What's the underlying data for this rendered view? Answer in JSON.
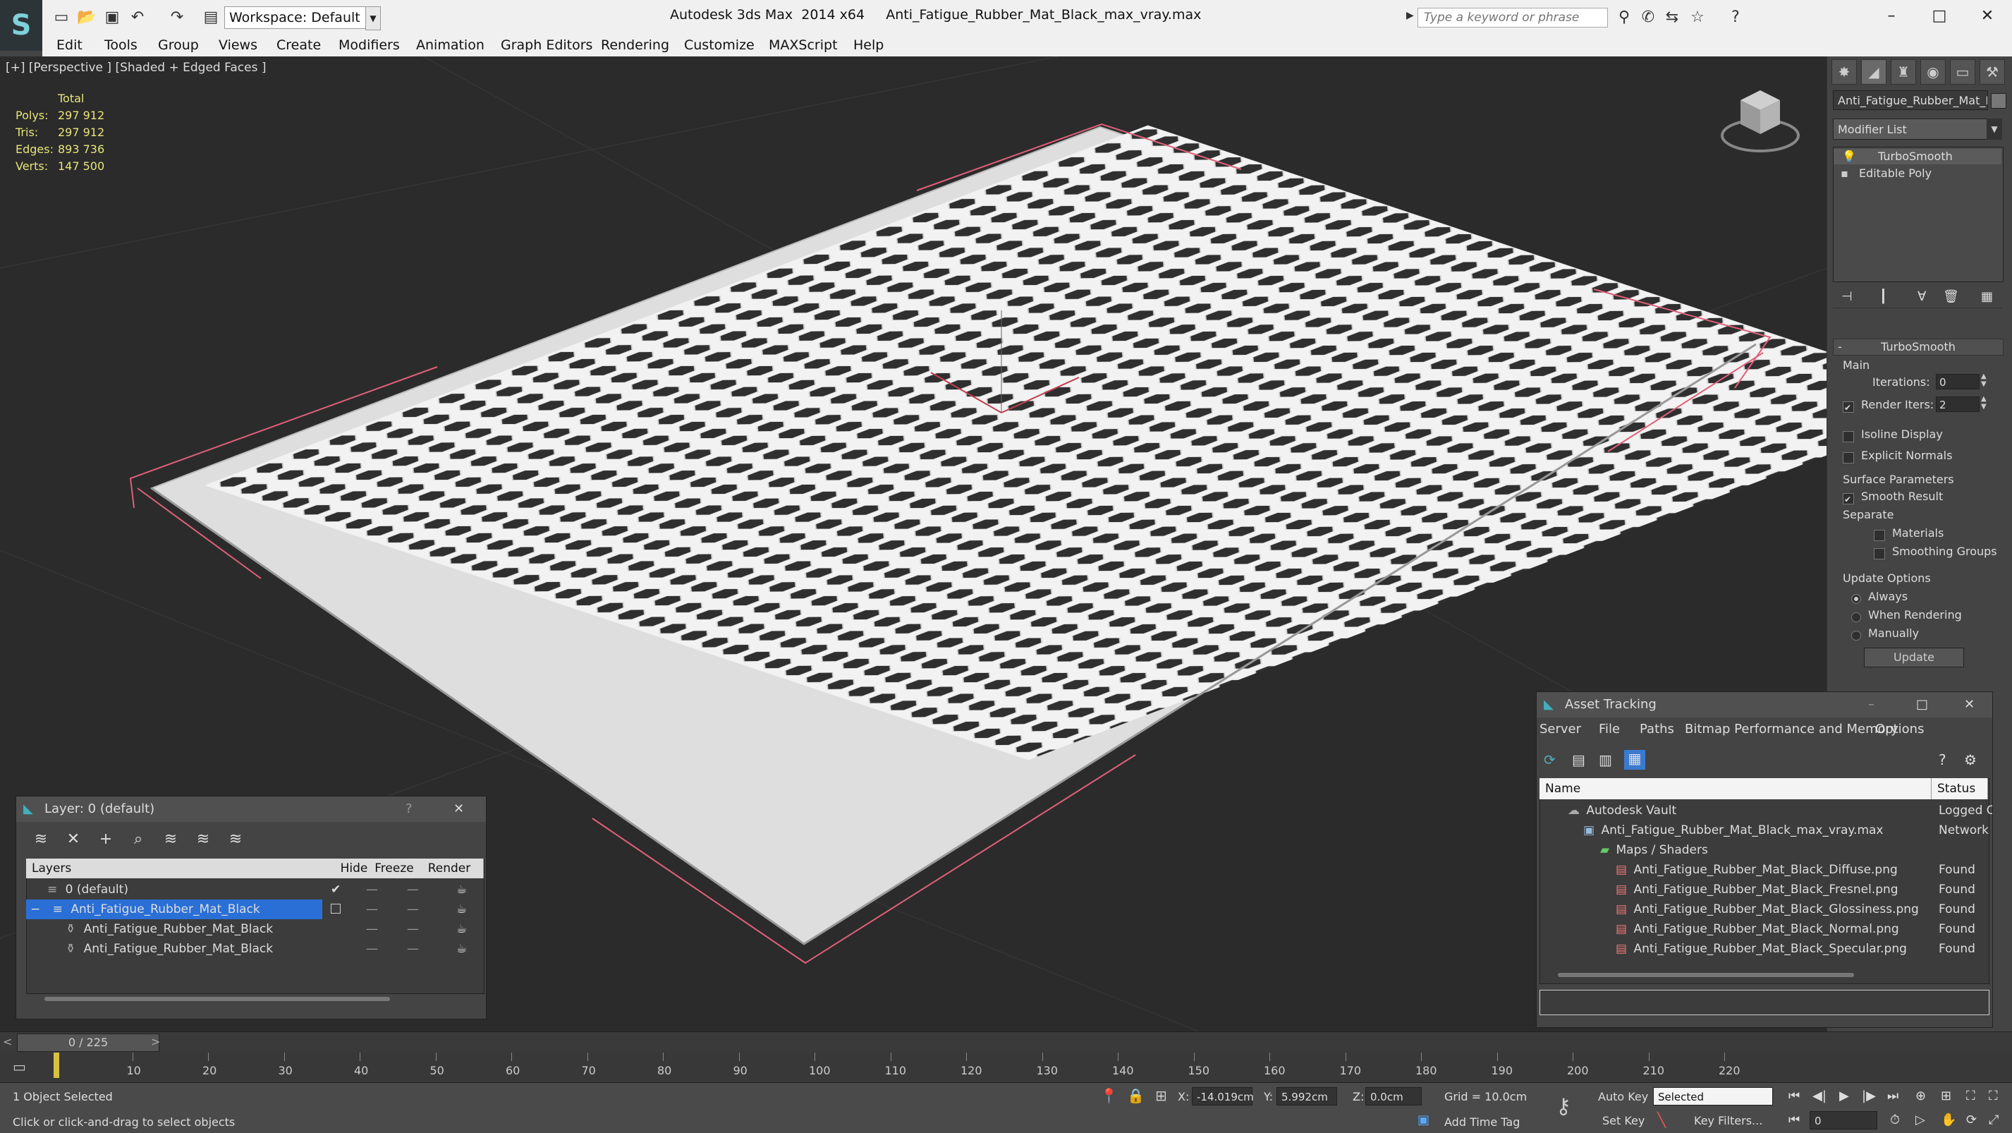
{
  "app": {
    "logo_glyph": "S",
    "title": "Autodesk 3ds Max  2014 x64     Anti_Fatigue_Rubber_Mat_Black_max_vray.max",
    "workspace": "Workspace: Default",
    "search_placeholder": "Type a keyword or phrase"
  },
  "menu": [
    "Edit",
    "Tools",
    "Group",
    "Views",
    "Create",
    "Modifiers",
    "Animation",
    "Graph Editors",
    "Rendering",
    "Customize",
    "MAXScript",
    "Help"
  ],
  "viewport": {
    "label": "[+] [Perspective ] [Shaded + Edged Faces ]",
    "stats": {
      "header": "Total",
      "rows": [
        {
          "label": "Polys:",
          "value": "297 912"
        },
        {
          "label": "Tris:",
          "value": "297 912"
        },
        {
          "label": "Edges:",
          "value": "893 736"
        },
        {
          "label": "Verts:",
          "value": "147 500"
        }
      ]
    }
  },
  "command_panel": {
    "object_name": "Anti_Fatigue_Rubber_Mat_Bl",
    "modifier_list": "Modifier List",
    "stack": [
      "TurboSmooth",
      "Editable Poly"
    ],
    "rollout_title": "TurboSmooth",
    "main_label": "Main",
    "iterations_label": "Iterations:",
    "iterations_value": "0",
    "render_iters_label": "Render Iters:",
    "render_iters_value": "2",
    "isoline": "Isoline Display",
    "explicit": "Explicit Normals",
    "surface_params": "Surface Parameters",
    "smooth_result": "Smooth Result",
    "separate": "Separate",
    "materials": "Materials",
    "smoothing_groups": "Smoothing Groups",
    "update_options": "Update Options",
    "always": "Always",
    "when_rendering": "When Rendering",
    "manually": "Manually",
    "update_button": "Update"
  },
  "layer_window": {
    "title": "Layer: 0 (default)",
    "help": "?",
    "close": "✕",
    "columns": [
      "Layers",
      "Hide",
      "Freeze",
      "Render"
    ],
    "rows": [
      {
        "name": "0 (default)",
        "selected": false,
        "indent": 0
      },
      {
        "name": "Anti_Fatigue_Rubber_Mat_Black",
        "selected": true,
        "indent": 0
      },
      {
        "name": "Anti_Fatigue_Rubber_Mat_Black",
        "selected": false,
        "indent": 1
      },
      {
        "name": "Anti_Fatigue_Rubber_Mat_Black",
        "selected": false,
        "indent": 1
      }
    ]
  },
  "asset_window": {
    "title": "Asset Tracking",
    "menu": [
      "Server",
      "File",
      "Paths",
      "Bitmap Performance and Memory",
      "Options"
    ],
    "columns": [
      "Name",
      "Status"
    ],
    "rows": [
      {
        "name": "Autodesk Vault",
        "status": "Logged O",
        "indent": 1
      },
      {
        "name": "Anti_Fatigue_Rubber_Mat_Black_max_vray.max",
        "status": "Network",
        "indent": 2
      },
      {
        "name": "Maps / Shaders",
        "status": "",
        "indent": 3
      },
      {
        "name": "Anti_Fatigue_Rubber_Mat_Black_Diffuse.png",
        "status": "Found",
        "indent": 4
      },
      {
        "name": "Anti_Fatigue_Rubber_Mat_Black_Fresnel.png",
        "status": "Found",
        "indent": 4
      },
      {
        "name": "Anti_Fatigue_Rubber_Mat_Black_Glossiness.png",
        "status": "Found",
        "indent": 4
      },
      {
        "name": "Anti_Fatigue_Rubber_Mat_Black_Normal.png",
        "status": "Found",
        "indent": 4
      },
      {
        "name": "Anti_Fatigue_Rubber_Mat_Black_Specular.png",
        "status": "Found",
        "indent": 4
      }
    ]
  },
  "timeline": {
    "frame": "0 / 225",
    "ticks": [
      "10",
      "20",
      "30",
      "40",
      "50",
      "60",
      "70",
      "80",
      "90",
      "100",
      "110",
      "120",
      "130",
      "140",
      "150",
      "160",
      "170",
      "180",
      "190",
      "200",
      "210",
      "220"
    ]
  },
  "status": {
    "selection": "1 Object Selected",
    "prompt": "Click or click-and-drag to select objects",
    "x_label": "X:",
    "x_value": "-14.019cm",
    "y_label": "Y:",
    "y_value": "5.992cm",
    "z_label": "Z:",
    "z_value": "0.0cm",
    "grid": "Grid = 10.0cm",
    "add_time_tag": "Add Time Tag",
    "auto_key": "Auto Key",
    "selected": "Selected",
    "set_key": "Set Key",
    "key_filters": "Key Filters...",
    "frame_value": "0"
  },
  "colors": {
    "selection_blue": "#2a6fd6",
    "stat_yellow": "#e8e47a",
    "bbox_pink": "#e0607a"
  }
}
